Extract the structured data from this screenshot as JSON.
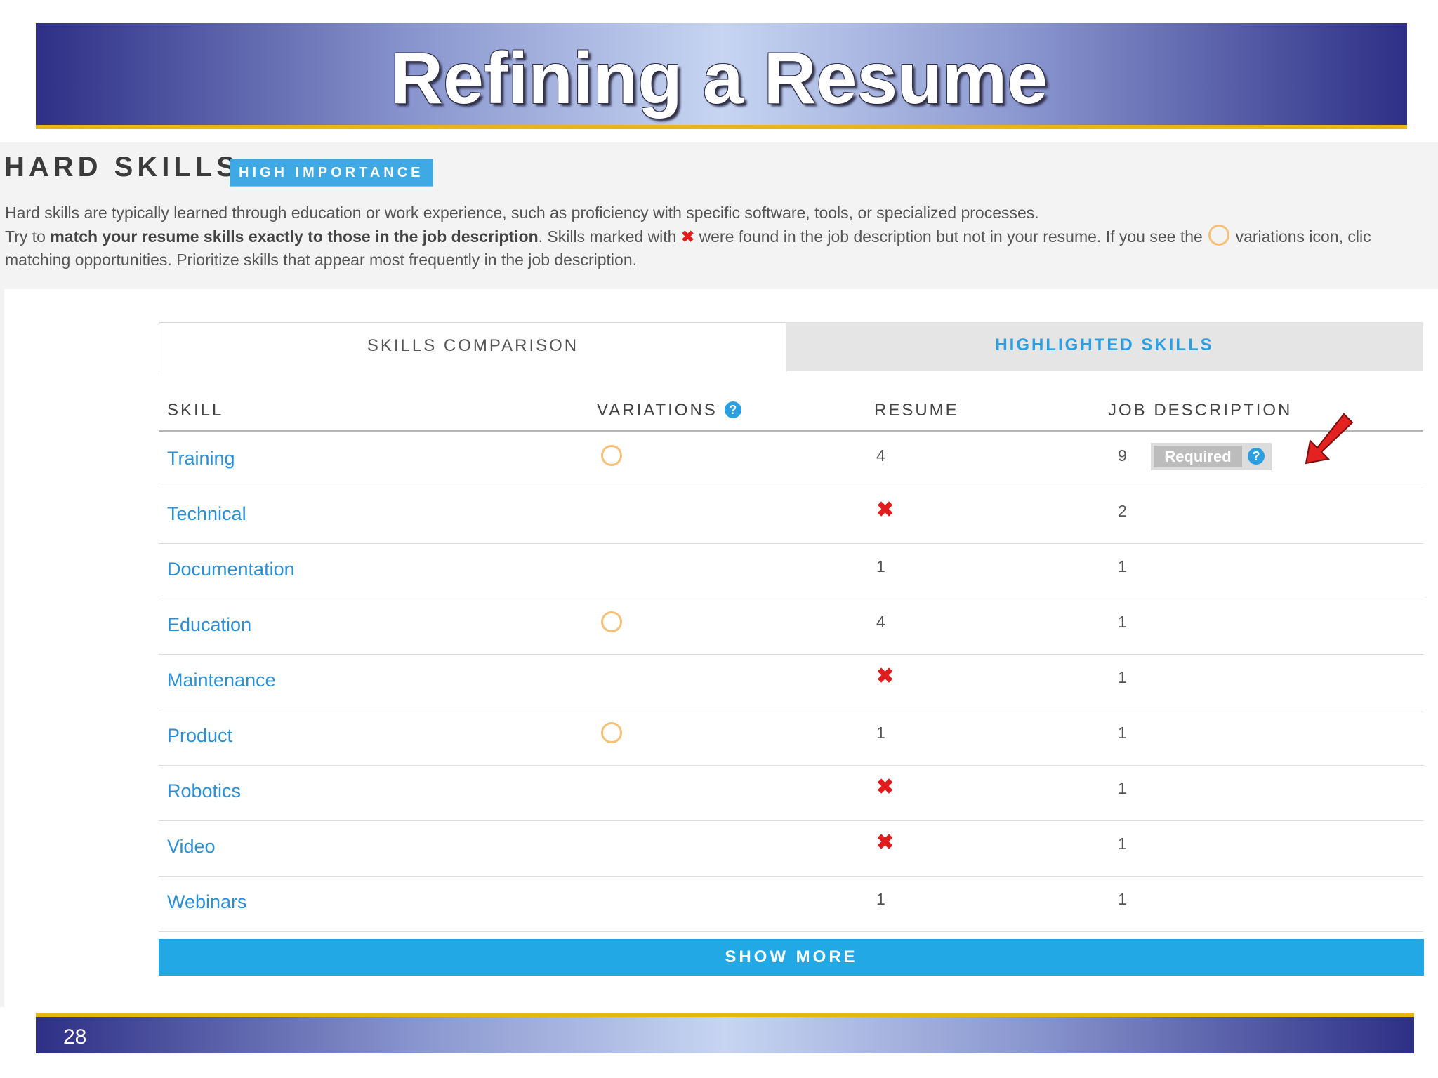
{
  "slide": {
    "title": "Refining a Resume",
    "page_number": "28"
  },
  "section": {
    "header": "HARD SKILLS",
    "badge": "HIGH IMPORTANCE",
    "desc_line1": "Hard skills are typically learned through education or work experience, such as proficiency with specific software, tools, or specialized processes.",
    "desc_line2_a": "Try to ",
    "desc_line2_bold": "match your resume skills exactly to those in the job description",
    "desc_line2_b": ". Skills marked with ",
    "desc_line2_c": " were found in the job description but not in your resume. If you see the ",
    "desc_line2_d": " variations icon, clic",
    "desc_line3": "matching opportunities. Prioritize skills that appear most frequently in the job description."
  },
  "tabs": [
    {
      "label": "SKILLS COMPARISON",
      "active": true
    },
    {
      "label": "HIGHLIGHTED SKILLS",
      "active": false
    }
  ],
  "table": {
    "headers": {
      "skill": "SKILL",
      "variations": "VARIATIONS",
      "resume": "RESUME",
      "job": "JOB DESCRIPTION"
    },
    "required_label": "Required",
    "rows": [
      {
        "skill": "Training",
        "variations": true,
        "resume": "4",
        "resume_missing": false,
        "job": "9",
        "required": true
      },
      {
        "skill": "Technical",
        "variations": false,
        "resume": "",
        "resume_missing": true,
        "job": "2",
        "required": false
      },
      {
        "skill": "Documentation",
        "variations": false,
        "resume": "1",
        "resume_missing": false,
        "job": "1",
        "required": false
      },
      {
        "skill": "Education",
        "variations": true,
        "resume": "4",
        "resume_missing": false,
        "job": "1",
        "required": false
      },
      {
        "skill": "Maintenance",
        "variations": false,
        "resume": "",
        "resume_missing": true,
        "job": "1",
        "required": false
      },
      {
        "skill": "Product",
        "variations": true,
        "resume": "1",
        "resume_missing": false,
        "job": "1",
        "required": false
      },
      {
        "skill": "Robotics",
        "variations": false,
        "resume": "",
        "resume_missing": true,
        "job": "1",
        "required": false
      },
      {
        "skill": "Video",
        "variations": false,
        "resume": "",
        "resume_missing": true,
        "job": "1",
        "required": false
      },
      {
        "skill": "Webinars",
        "variations": false,
        "resume": "1",
        "resume_missing": false,
        "job": "1",
        "required": false
      }
    ]
  },
  "show_more_label": "SHOW MORE",
  "icons": {
    "missing_mark": "✖",
    "help_glyph": "?",
    "variations_icon": "ring-icon",
    "annotation": "red-arrow-icon"
  },
  "colors": {
    "accent_blue": "#2b9fe0",
    "missing_red": "#e01c1c",
    "variations_orange": "#f5c078",
    "banner_gold": "#e5b614",
    "banner_navy": "#2e2f86"
  }
}
